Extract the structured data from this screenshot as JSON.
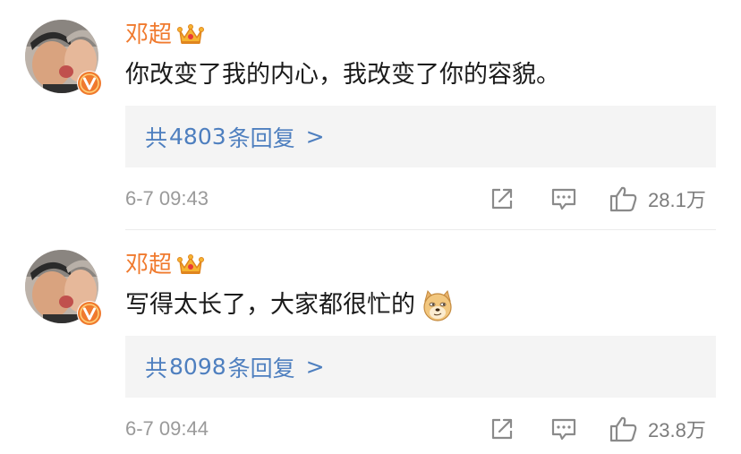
{
  "comments": [
    {
      "username": "邓超",
      "text": "你改变了我的内心，我改变了你的容貌。",
      "replies": {
        "prefix": "共",
        "count": "4803",
        "suffix": "条回复",
        "chevron": ">"
      },
      "time": "6-7 09:43",
      "likes": "28.1万"
    },
    {
      "username": "邓超",
      "text": "写得太长了，大家都很忙的",
      "emoji": "doge-emoji",
      "replies": {
        "prefix": "共",
        "count": "8098",
        "suffix": "条回复",
        "chevron": ">"
      },
      "time": "6-7 09:44",
      "likes": "23.8万"
    }
  ],
  "icons": {
    "verified": "verified-v-icon",
    "member": "crown-icon",
    "share": "share-icon",
    "comment": "comment-icon",
    "like": "thumbs-up-icon"
  },
  "colors": {
    "username": "#f07a2e",
    "link": "#4e7fbf",
    "muted": "#9a9a9a",
    "reply_bg": "#f4f4f4",
    "verified": "#f07a2e"
  }
}
